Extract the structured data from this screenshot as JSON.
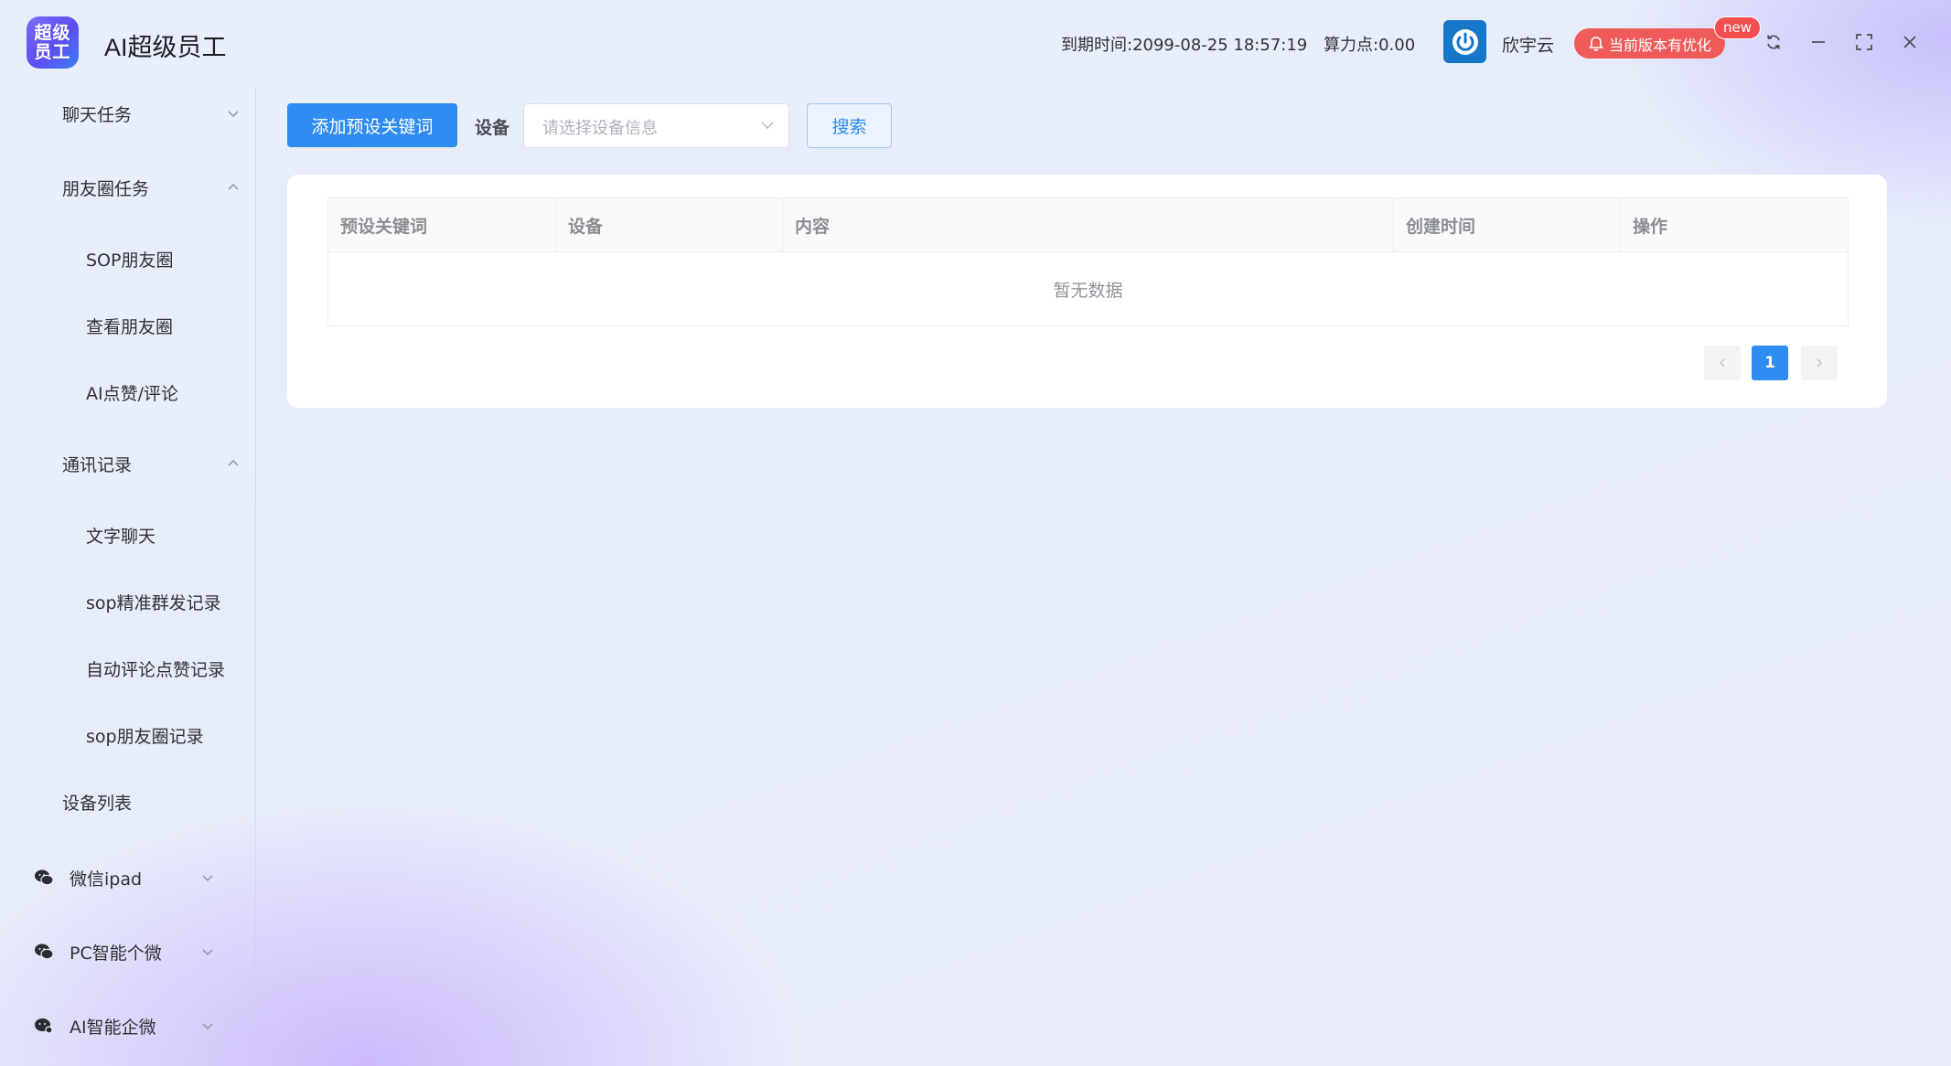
{
  "app": {
    "logo_text": "超级员工",
    "title": "AI超级员工"
  },
  "header": {
    "expire_label": "到期时间:2099-08-25 18:57:19",
    "power_label": "算力点:0.00",
    "user_name": "欣宇云",
    "update_notice": "当前版本有优化",
    "new_tag": "new",
    "icons": [
      "power-icon",
      "bell-icon",
      "refresh-icon",
      "minimize-icon",
      "fullscreen-icon",
      "close-icon"
    ]
  },
  "sidebar": {
    "items": [
      {
        "label": "聊天任务",
        "expanded": false
      },
      {
        "label": "朋友圈任务",
        "expanded": true
      },
      {
        "label": "SOP朋友圈"
      },
      {
        "label": "查看朋友圈"
      },
      {
        "label": "AI点赞/评论"
      },
      {
        "label": "通讯记录",
        "expanded": true
      },
      {
        "label": "文字聊天"
      },
      {
        "label": "sop精准群发记录"
      },
      {
        "label": "自动评论点赞记录"
      },
      {
        "label": "sop朋友圈记录"
      },
      {
        "label": "设备列表"
      },
      {
        "label": "微信ipad",
        "expanded": false,
        "icon": "wechat-icon"
      },
      {
        "label": "PC智能个微",
        "expanded": false,
        "icon": "wechat-icon"
      },
      {
        "label": "AI智能企微",
        "expanded": false,
        "icon": "wecom-icon"
      }
    ]
  },
  "toolbar": {
    "add_button": "添加预设关键词",
    "device_label": "设备",
    "device_placeholder": "请选择设备信息",
    "search_button": "搜索"
  },
  "table": {
    "columns": [
      "预设关键词",
      "设备",
      "内容",
      "创建时间",
      "操作"
    ],
    "empty_text": "暂无数据"
  },
  "pagination": {
    "current_page": "1",
    "prev_icon": "chevron-left-icon",
    "next_icon": "chevron-right-icon"
  },
  "colors": {
    "primary": "#2f8cf0",
    "badge_red": "#ef5a5a",
    "avatar_blue": "#1677c9"
  }
}
